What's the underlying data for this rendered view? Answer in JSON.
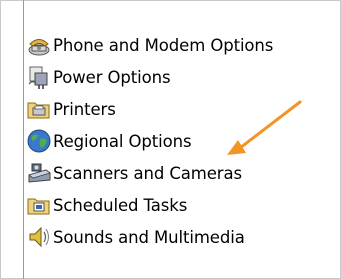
{
  "items": [
    {
      "label": "Phone and Modem Options",
      "icon": "phone-icon"
    },
    {
      "label": "Power Options",
      "icon": "power-plug-icon"
    },
    {
      "label": "Printers",
      "icon": "printer-folder-icon"
    },
    {
      "label": "Regional Options",
      "icon": "globe-icon"
    },
    {
      "label": "Scanners and Cameras",
      "icon": "scanner-camera-icon"
    },
    {
      "label": "Scheduled Tasks",
      "icon": "scheduled-tasks-folder-icon"
    },
    {
      "label": "Sounds and Multimedia",
      "icon": "speaker-icon"
    }
  ],
  "colors": {
    "arrow": "#f29426",
    "divider": "#9a9a9a",
    "border": "#c9c9c9"
  }
}
